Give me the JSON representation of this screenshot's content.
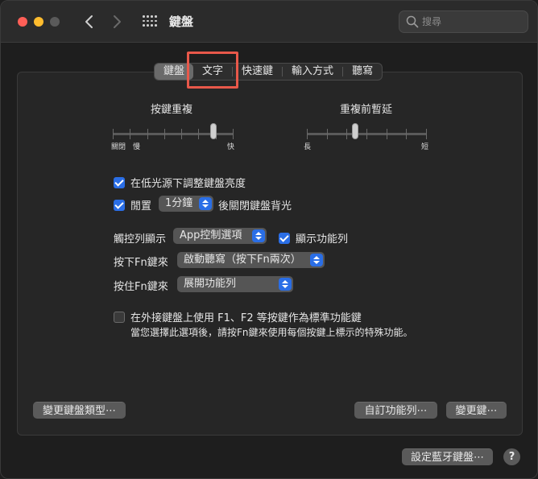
{
  "window": {
    "title": "鍵盤"
  },
  "search": {
    "placeholder": "搜尋"
  },
  "tabs": [
    {
      "label": "鍵盤",
      "active": true
    },
    {
      "label": "文字",
      "active": false
    },
    {
      "label": "快速鍵",
      "active": false
    },
    {
      "label": "輸入方式",
      "active": false
    },
    {
      "label": "聽寫",
      "active": false
    }
  ],
  "key_repeat": {
    "title": "按鍵重複",
    "left_label_1": "關閉",
    "left_label_2": "慢",
    "right_label": "快",
    "level": 0.85
  },
  "delay_until_repeat": {
    "title": "重複前暫延",
    "left_label": "長",
    "right_label": "短",
    "level": 0.4
  },
  "options": {
    "adjust_brightness": {
      "label": "在低光源下調整鍵盤亮度",
      "checked": true
    },
    "backlight_off": {
      "label_before": "閒置",
      "popup_value": "1分鐘",
      "label_after": "後關閉鍵盤背光",
      "checked": true
    }
  },
  "touch_bar": {
    "label": "觸控列顯示",
    "popup_value": "App控制選項",
    "show_fn_label": "顯示功能列",
    "show_fn_checked": true
  },
  "press_fn": {
    "label": "按下Fn鍵來",
    "popup_value": "啟動聽寫（按下Fn兩次）"
  },
  "hold_fn": {
    "label": "按住Fn鍵來",
    "popup_value": "展開功能列"
  },
  "function_keys": {
    "label": "在外接鍵盤上使用 F1、F2 等按鍵作為標準功能鍵",
    "subtext": "當您選擇此選項後，請按Fn鍵來使用每個按鍵上標示的特殊功能。",
    "checked": false
  },
  "buttons": {
    "change_keyboard_type": "變更鍵盤類型⋯",
    "customize_control_strip": "自訂功能列⋯",
    "modifier_keys": "變更鍵⋯",
    "setup_bluetooth": "設定藍牙鍵盤⋯",
    "help": "?"
  },
  "colors": {
    "accent": "#2a6ee6",
    "highlight": "#e8584a"
  }
}
